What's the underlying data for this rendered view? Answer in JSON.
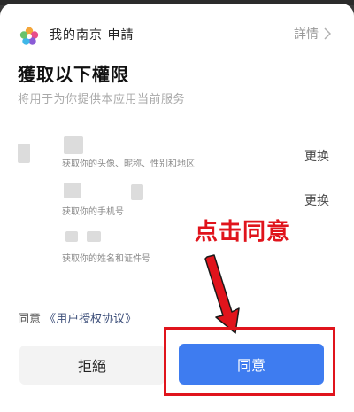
{
  "header": {
    "app_name": "我的南京  申請",
    "detail_label": "詳情"
  },
  "title": "獲取以下權限",
  "subtitle": "将用于为你提供本应用当前服务",
  "permissions": [
    {
      "label": "获取你的头像、昵称、性别和地区",
      "action": "更换"
    },
    {
      "label": "获取你的手机号",
      "action": "更换"
    },
    {
      "label": "获取你的姓名和证件号",
      "action": ""
    }
  ],
  "agreement": {
    "prefix": "同意",
    "link": "《用户授权协议》"
  },
  "callout": "点击同意",
  "buttons": {
    "reject": "拒絕",
    "agree": "同意"
  },
  "colors": {
    "primary": "#3e7cf0",
    "annotation": "#e0141c"
  }
}
